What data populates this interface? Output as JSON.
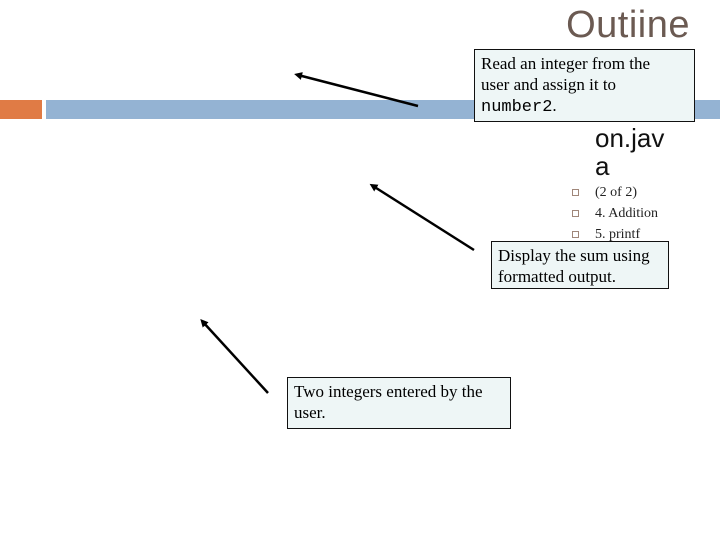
{
  "slide": {
    "title": "Outiine",
    "body_text_line1": "on.jav",
    "body_text_line2": "a",
    "bullets": [
      {
        "icon": "square-bullet-icon",
        "label": "(2 of 2)"
      },
      {
        "icon": "square-bullet-icon",
        "label": "4. Addition"
      },
      {
        "icon": "square-bullet-icon",
        "label": "5. printf"
      }
    ]
  },
  "accent": {
    "orange": "#e07b45",
    "blue": "#94b3d3",
    "title_color": "#6b5a52",
    "callout_bg": "#eef6f6"
  },
  "callouts": {
    "read": {
      "text_line1": "Read an integer from the",
      "text_line2": "user and assign it to",
      "code": "number2",
      "code_suffix": "."
    },
    "display": {
      "text_line1": "Display the sum using",
      "text_line2": "formatted output."
    },
    "two": {
      "text_line1": "Two integers entered by the",
      "text_line2": "user."
    }
  },
  "arrows": [
    {
      "name": "arrow-read",
      "icon": "arrow-icon"
    },
    {
      "name": "arrow-display",
      "icon": "arrow-icon"
    },
    {
      "name": "arrow-two",
      "icon": "arrow-icon"
    }
  ]
}
